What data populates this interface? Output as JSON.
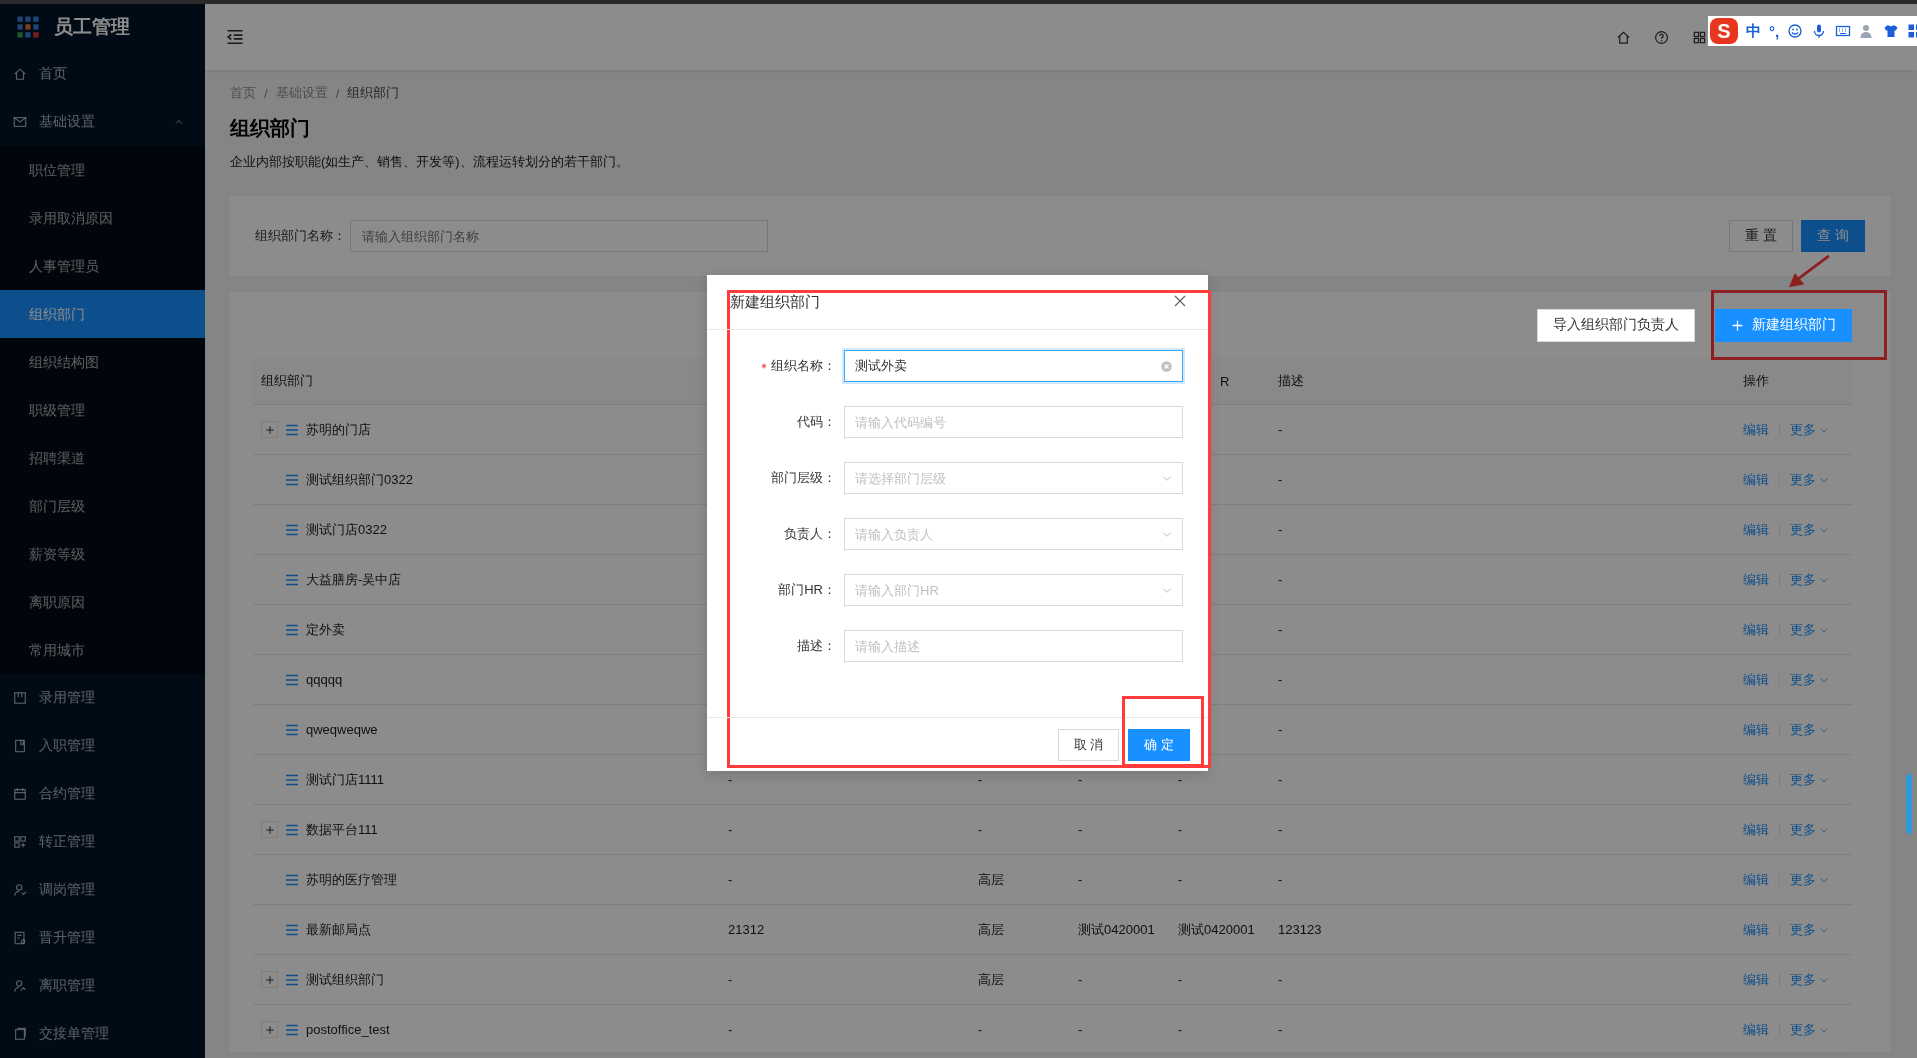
{
  "app": {
    "title": "员工管理"
  },
  "sidebar": {
    "items": [
      {
        "label": "首页",
        "selected": false
      },
      {
        "label": "基础设置",
        "selected": false,
        "expanded": true,
        "children": [
          {
            "label": "职位管理",
            "selected": false
          },
          {
            "label": "录用取消原因",
            "selected": false
          },
          {
            "label": "人事管理员",
            "selected": false
          },
          {
            "label": "组织部门",
            "selected": true
          },
          {
            "label": "组织结构图",
            "selected": false
          },
          {
            "label": "职级管理",
            "selected": false
          },
          {
            "label": "招聘渠道",
            "selected": false
          },
          {
            "label": "部门层级",
            "selected": false
          },
          {
            "label": "薪资等级",
            "selected": false
          },
          {
            "label": "离职原因",
            "selected": false
          },
          {
            "label": "常用城市",
            "selected": false
          }
        ]
      },
      {
        "label": "录用管理",
        "selected": false
      },
      {
        "label": "入职管理",
        "selected": false
      },
      {
        "label": "合约管理",
        "selected": false
      },
      {
        "label": "转正管理",
        "selected": false
      },
      {
        "label": "调岗管理",
        "selected": false
      },
      {
        "label": "晋升管理",
        "selected": false
      },
      {
        "label": "离职管理",
        "selected": false
      },
      {
        "label": "交接单管理",
        "selected": false
      }
    ]
  },
  "ime_bar": {
    "logo": "S",
    "mode": "中",
    "punctuation": "°,"
  },
  "breadcrumb": {
    "items": [
      "首页",
      "基础设置",
      "组织部门"
    ],
    "separators": [
      "/",
      "/"
    ]
  },
  "page": {
    "title": "组织部门",
    "description": "企业内部按职能(如生产、销售、开发等)、流程运转划分的若干部门。"
  },
  "search": {
    "label": "组织部门名称：",
    "placeholder": "请输入组织部门名称",
    "buttons": [
      "重 置",
      "查 询"
    ]
  },
  "toolbar": {
    "buttons": [
      "导入组织部门负责人",
      "新建组织部门"
    ]
  },
  "table": {
    "columns": {
      "name": "组织部门",
      "column_5": "R",
      "description": "描述",
      "actions": "操作"
    },
    "rows": [
      {
        "name": "苏明的门店",
        "expanded": false,
        "description": "-",
        "actions": [
          "编辑",
          "更多"
        ]
      },
      {
        "name": "测试组织部门0322",
        "description": "-",
        "actions": [
          "编辑",
          "更多"
        ]
      },
      {
        "name": "测试门店0322",
        "description": "-",
        "actions": [
          "编辑",
          "更多"
        ]
      },
      {
        "name": "大益膳房-吴中店",
        "description": "-",
        "actions": [
          "编辑",
          "更多"
        ]
      },
      {
        "name": "定外卖",
        "description": "-",
        "actions": [
          "编辑",
          "更多"
        ]
      },
      {
        "name": "qqqqq",
        "description": "-",
        "actions": [
          "编辑",
          "更多"
        ]
      },
      {
        "name": "qweqweqwe",
        "description": "-",
        "actions": [
          "编辑",
          "更多"
        ]
      },
      {
        "name": "测试门店1111",
        "code": "-",
        "level": "-",
        "column_4": "-",
        "column_5": "-",
        "description": "-",
        "actions": [
          "编辑",
          "更多"
        ]
      },
      {
        "name": "数据平台111",
        "expanded": false,
        "code": "-",
        "level": "-",
        "column_4": "-",
        "column_5": "-",
        "description": "-",
        "actions": [
          "编辑",
          "更多"
        ]
      },
      {
        "name": "苏明的医疗管理",
        "code": "-",
        "level": "高层",
        "column_4": "-",
        "column_5": "-",
        "description": "-",
        "actions": [
          "编辑",
          "更多"
        ]
      },
      {
        "name": "最新邮局点",
        "code": "21312",
        "level": "高层",
        "column_4": "测试0420001",
        "column_5": "测试0420001",
        "description": "123123",
        "actions": [
          "编辑",
          "更多"
        ]
      },
      {
        "name": "测试组织部门",
        "expanded": false,
        "code": "-",
        "level": "高层",
        "column_4": "-",
        "column_5": "-",
        "description": "-",
        "actions": [
          "编辑",
          "更多"
        ]
      },
      {
        "name": "postoffice_test",
        "expanded": false,
        "code": "-",
        "level": "-",
        "column_4": "-",
        "column_5": "-",
        "description": "-",
        "actions": [
          "编辑",
          "更多"
        ]
      }
    ]
  },
  "dialog": {
    "title": "新建组织部门",
    "highlighted": true,
    "fields": [
      {
        "label": "组织名称：",
        "required": true,
        "kind": "text",
        "value": "测试外卖",
        "focused": true
      },
      {
        "label": "代码：",
        "required": false,
        "kind": "text",
        "placeholder": "请输入代码编号",
        "focused": false
      },
      {
        "label": "部门层级：",
        "required": false,
        "kind": "select",
        "placeholder": "请选择部门层级",
        "focused": false
      },
      {
        "label": "负责人：",
        "required": false,
        "kind": "select",
        "placeholder": "请输入负责人",
        "focused": false
      },
      {
        "label": "部门HR：",
        "required": false,
        "kind": "select",
        "placeholder": "请输入部门HR",
        "focused": false
      },
      {
        "label": "描述：",
        "required": false,
        "kind": "text",
        "placeholder": "请输入描述",
        "focused": false
      }
    ],
    "buttons": [
      {
        "label": "取 消",
        "kind": "default",
        "highlighted": false
      },
      {
        "label": "确 定",
        "kind": "primary",
        "highlighted": true
      }
    ]
  },
  "annotations": {
    "create_button_frame": true,
    "arrow": true
  }
}
